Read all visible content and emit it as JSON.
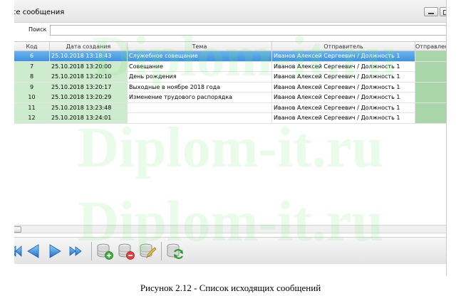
{
  "window": {
    "title": "Все сообщения"
  },
  "search": {
    "label": "Поиск",
    "value": ""
  },
  "grid": {
    "columns": [
      "Код",
      "Дата создания",
      "Тема",
      "Отправитель",
      "Отправлено"
    ],
    "rows": [
      {
        "code": "6",
        "date": "25.10.2018 13:18:43",
        "topic": "Служебное совещание",
        "sender": "Иванов Алексей Сергеевич / Должность 1",
        "sent": "",
        "selected": true
      },
      {
        "code": "7",
        "date": "25.10.2018 13:20:00",
        "topic": "Совещание",
        "sender": "Иванов Алексей Сергеевич / Должность 1",
        "sent": "",
        "selected": false
      },
      {
        "code": "8",
        "date": "25.10.2018 13:20:10",
        "topic": "День рождения",
        "sender": "Иванов Алексей Сергеевич / Должность 1",
        "sent": "",
        "selected": false
      },
      {
        "code": "9",
        "date": "25.10.2018 13:20:17",
        "topic": "Выходные в ноябре 2018 года",
        "sender": "Иванов Алексей Сергеевич / Должность 1",
        "sent": "",
        "selected": false
      },
      {
        "code": "10",
        "date": "25.10.2018 13:20:29",
        "topic": "Изменение трудового распорядка",
        "sender": "Иванов Алексей Сергеевич / Должность 1",
        "sent": "",
        "selected": false
      },
      {
        "code": "11",
        "date": "25.10.2018 13:23:48",
        "topic": "",
        "sender": "Иванов Алексей Сергеевич / Должность 1",
        "sent": "",
        "selected": false
      },
      {
        "code": "12",
        "date": "25.10.2018 13:24:01",
        "topic": "",
        "sender": "Иванов Алексей Сергеевич / Должность 1",
        "sent": "",
        "selected": false
      }
    ]
  },
  "toolbar": {
    "icons": [
      "first-icon",
      "prev-icon",
      "next-icon",
      "last-icon",
      "add-record-icon",
      "delete-record-icon",
      "edit-record-icon",
      "refresh-icon"
    ]
  },
  "colors": {
    "selected_row": "#3e92dd",
    "code_date_bg": "#cdebcd",
    "sent_bg": "#a8d6a8"
  },
  "watermark": {
    "text": "Diplom-it.ru"
  },
  "caption": "Рисунок 2.12 - Список исходящих сообщений"
}
